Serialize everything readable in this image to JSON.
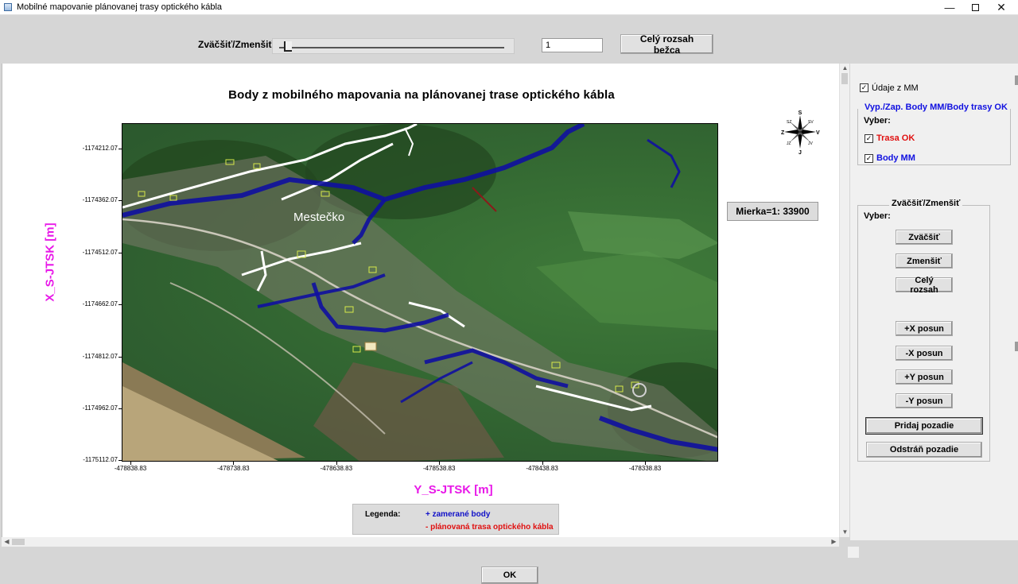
{
  "window": {
    "title": "Mobilné mapovanie plánovanej trasy optického kábla",
    "minimize_icon": "minimize-icon",
    "maximize_icon": "maximize-icon",
    "close_icon": "close-icon",
    "minimize_glyph": "—",
    "close_glyph": "✕"
  },
  "toolbar": {
    "zoom_label": "Zväčšiť/Zmenšiť:",
    "zoom_slider_value": 0.02,
    "zoom_value": "1",
    "full_range_button": "Celý rozsah bežca"
  },
  "map": {
    "title": "Body z mobilného mapovania na plánovanej trase optického kábla",
    "x_axis_label": "Y_S-JTSK [m]",
    "y_axis_label": "X_S-JTSK [m]",
    "y_ticks": [
      "-1174212.07",
      "-1174362.07",
      "-1174512.07",
      "-1174662.07",
      "-1174812.07",
      "-1174962.07",
      "-1175112.07"
    ],
    "x_ticks": [
      "-478838.83",
      "-478738.83",
      "-478638.83",
      "-478538.83",
      "-478438.83",
      "-478338.83"
    ],
    "place_label": "Mestečko",
    "scale_text": "Mierka=1: 33900",
    "compass": {
      "north": "S",
      "south": "J",
      "west": "Z",
      "east": "V",
      "nw": "SZ",
      "ne": "SV",
      "sw": "JZ",
      "se": "JV"
    },
    "legend": {
      "title": "Legenda:",
      "points": "+ zamerané body",
      "route": "- plánovaná trasa optického kábla"
    },
    "colors": {
      "points": "#1010c8",
      "route": "#e01010",
      "axis_label": "#e818e8"
    }
  },
  "right_panel": {
    "mm_data_label": "Údaje z MM",
    "mm_data_checked": true,
    "toggle_group_title": "Vyp./Zap. Body MM/Body trasy OK",
    "select_label": "Vyber:",
    "route_ok_label": "Trasa OK",
    "route_ok_checked": true,
    "points_mm_label": "Body MM",
    "points_mm_checked": true,
    "zoom_group_title": "Zväčšiť/Zmenšiť",
    "zoom_select_label": "Vyber:",
    "zoom_in_button": "Zväčšiť",
    "zoom_out_button": "Zmenšiť",
    "full_range_button": "Celý rozsah",
    "plus_x_button": "+X posun",
    "minus_x_button": "-X posun",
    "plus_y_button": "+Y posun",
    "minus_y_button": "-Y posun",
    "add_background_button": "Pridaj pozadie",
    "remove_background_button": "Odstráň pozadie",
    "check_glyph": "✓"
  },
  "footer": {
    "ok_button": "OK"
  }
}
